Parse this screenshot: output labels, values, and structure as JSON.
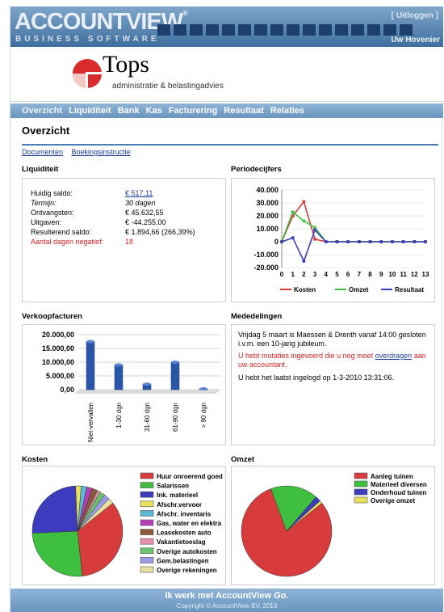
{
  "app": {
    "logo": "ACCOUNTVIEW",
    "logo_sub": "BUSINESS SOFTWARE",
    "logout": "[ Uitloggen ]",
    "user": "Uw Hovenier"
  },
  "client": {
    "name": "Tops",
    "tagline": "administratie & belastingadvies"
  },
  "menu": [
    "Overzicht",
    "Liquiditeit",
    "Bank",
    "Kas",
    "Facturering",
    "Resultaat",
    "Relaties"
  ],
  "page": {
    "title": "Overzicht",
    "links": [
      "Documenten",
      "Boekingsinstructie"
    ]
  },
  "liquiditeit": {
    "title": "Liquiditeit",
    "rows": [
      {
        "label": "Huidig saldo:",
        "value": "€ 517,11"
      },
      {
        "label": "Termijn:",
        "value": "30 dagen"
      },
      {
        "label": "Ontvangsten:",
        "value": "€ 45.632,55"
      },
      {
        "label": "Uitgaven:",
        "value": "€ -44.255,00"
      },
      {
        "label": "Resulterend saldo:",
        "value": "€ 1.894,66 (266,39%)"
      },
      {
        "label": "Aantal dagen negatief:",
        "value": "18"
      }
    ]
  },
  "periodecijfers_title": "Periodecijfers",
  "verkoopfacturen_title": "Verkoopfacturen",
  "mededelingen": {
    "title": "Mededelingen",
    "p1": "Vrijdag 5 maart is Maessen & Drenth vanaf 14:00 gesloten i.v.m. een 10-jarig jubileum.",
    "p2_text": "U hebt mutaties ingevoerd die u nog moet",
    "p2_link": "overdragen",
    "p2_end": "aan uw accountant.",
    "p3": "U hebt het laatst ingelogd op 1-3-2010 13:31:06."
  },
  "kosten_title": "Kosten",
  "omzet_title": "Omzet",
  "footer": {
    "text": "Ik werk met AccountView",
    "text_italic": "Go.",
    "copyright": "Copyright © AccountView BV, 2010"
  },
  "chart_data": [
    {
      "type": "line",
      "title": "Periodecijfers",
      "x": [
        0,
        1,
        2,
        3,
        4,
        5,
        6,
        7,
        8,
        9,
        10,
        11,
        12,
        13
      ],
      "ylim": [
        -20000,
        40000
      ],
      "yticks": [
        "40.000",
        "30.000",
        "20.000",
        "10.000",
        "0",
        "-10.000",
        "-20.000"
      ],
      "series": [
        {
          "name": "Kosten",
          "color": "#d83b3b",
          "values": [
            0,
            20000,
            31000,
            2000,
            0,
            0,
            0,
            0,
            0,
            0,
            0,
            0,
            0,
            0
          ]
        },
        {
          "name": "Omzet",
          "color": "#3fbf3f",
          "values": [
            0,
            23000,
            16000,
            11000,
            0,
            0,
            0,
            0,
            0,
            0,
            0,
            0,
            0,
            0
          ]
        },
        {
          "name": "Resultaat",
          "color": "#3c3cbf",
          "values": [
            0,
            3000,
            -15000,
            9000,
            0,
            0,
            0,
            0,
            0,
            0,
            0,
            0,
            0,
            0
          ]
        }
      ]
    },
    {
      "type": "bar",
      "title": "Verkoopfacturen",
      "categories": [
        "Niet-vervallen",
        "1-30 dgn",
        "31-60 dgn",
        "61-90 dgn",
        "> 90 dgn"
      ],
      "values": [
        17500,
        9000,
        2000,
        10000,
        300
      ],
      "ylim": [
        0,
        20000
      ],
      "yticks": [
        "20.000,00",
        "15.000,00",
        "10.000,00",
        "5.000,00",
        "0,00"
      ]
    },
    {
      "type": "pie",
      "title": "Kosten",
      "labels": [
        "Huur onroerend goed",
        "Salarissen",
        "Ink. materieel",
        "Afschr.vervoer",
        "Afschr. inventaris",
        "Gas, water en elektra",
        "Leasekosten auto",
        "Vakantietoeslag",
        "Overige autokosten",
        "Gem.belastingen",
        "Overige rekeningen"
      ],
      "colors": [
        "#d83b3b",
        "#3fbf3f",
        "#3c3cbf",
        "#e8e05a",
        "#5ab8d8",
        "#b83cb8",
        "#8a5a3a",
        "#e68fb0",
        "#6ac26a",
        "#9a9ae8",
        "#e8e0a0"
      ],
      "values": [
        34,
        26,
        25,
        2,
        2,
        2,
        2,
        1,
        2,
        2,
        2
      ]
    },
    {
      "type": "pie",
      "title": "Omzet",
      "labels": [
        "Aanleg tuinen",
        "Materieel diversen",
        "Onderhoud tuinen",
        "Overige omzet"
      ],
      "colors": [
        "#d83b3b",
        "#3fbf3f",
        "#3c3cbf",
        "#e8e05a"
      ],
      "values": [
        80,
        17,
        2,
        1
      ]
    }
  ]
}
